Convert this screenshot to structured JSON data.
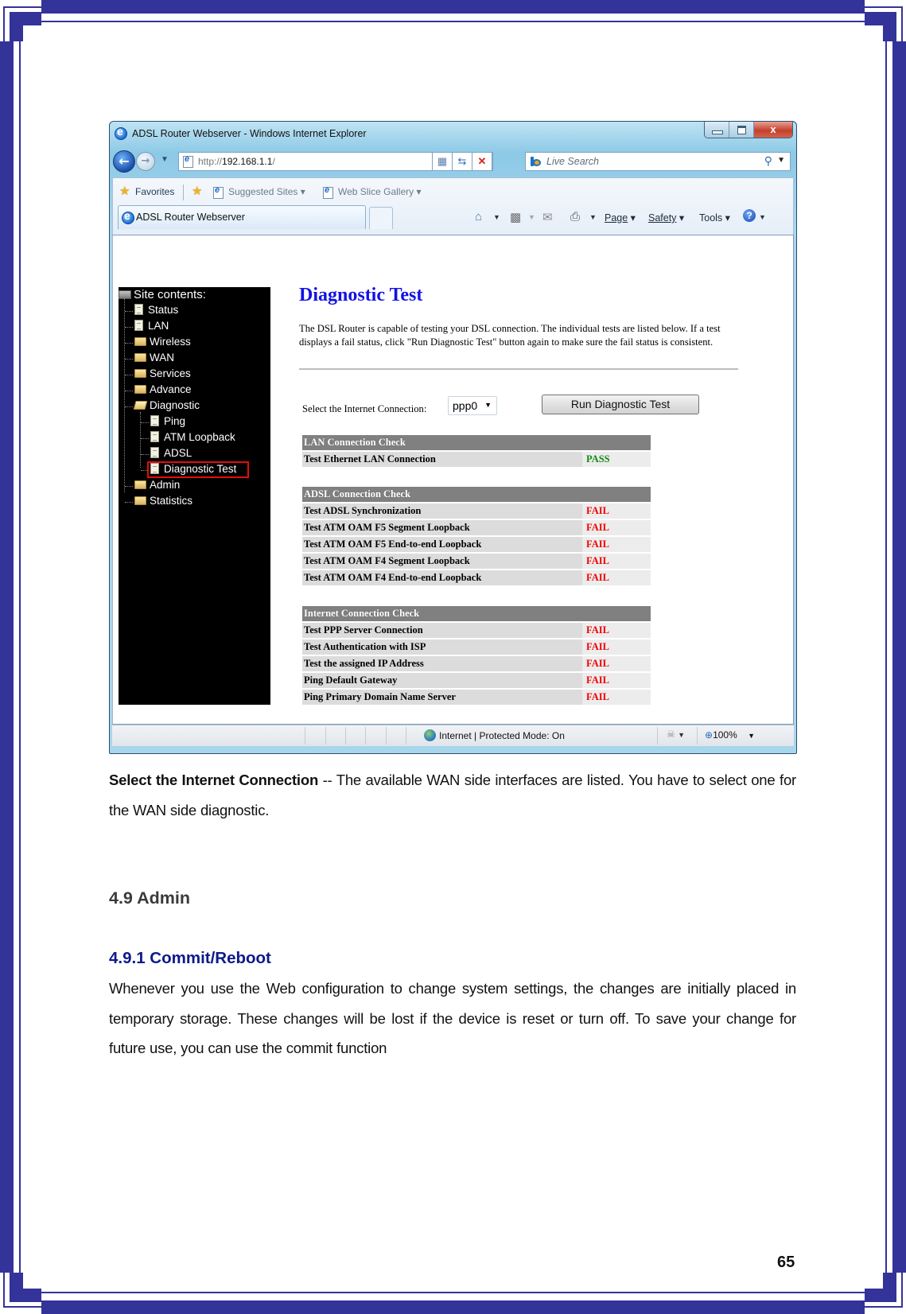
{
  "page": {
    "page_number": "65",
    "frame_color": "#33339a"
  },
  "browser": {
    "window_title": "ADSL Router Webserver - Windows Internet Explorer",
    "close_glyph": "x",
    "address_prefix": "http://",
    "address_host": "192.168.1.1",
    "address_suffix": "/",
    "search_placeholder": "Live Search",
    "favorites_label": "Favorites",
    "suggested_sites_label": "Suggested Sites",
    "web_slice_gallery_label": "Web Slice Gallery",
    "tab_title": "ADSL Router Webserver",
    "commands": {
      "page": "Page",
      "safety": "Safety",
      "tools": "Tools"
    },
    "status": {
      "zone": "Internet | Protected Mode: On",
      "zoom": "100%"
    }
  },
  "sidebar": {
    "root_label": "Site contents:",
    "items": [
      {
        "label": "Status",
        "type": "doc",
        "level": 1
      },
      {
        "label": "LAN",
        "type": "doc",
        "level": 1
      },
      {
        "label": "Wireless",
        "type": "folder",
        "level": 1
      },
      {
        "label": "WAN",
        "type": "folder",
        "level": 1
      },
      {
        "label": "Services",
        "type": "folder",
        "level": 1
      },
      {
        "label": "Advance",
        "type": "folder",
        "level": 1
      },
      {
        "label": "Diagnostic",
        "type": "folder-open",
        "level": 1
      },
      {
        "label": "Ping",
        "type": "doc",
        "level": 2
      },
      {
        "label": "ATM Loopback",
        "type": "doc",
        "level": 2
      },
      {
        "label": "ADSL",
        "type": "doc",
        "level": 2
      },
      {
        "label": "Diagnostic Test",
        "type": "doc",
        "level": 2,
        "selected": true
      },
      {
        "label": "Admin",
        "type": "folder",
        "level": 1
      },
      {
        "label": "Statistics",
        "type": "folder",
        "level": 1
      }
    ]
  },
  "main": {
    "title": "Diagnostic Test",
    "intro": "The DSL Router is capable of testing your DSL connection. The individual tests are listed below. If a test displays a fail status, click \"Run Diagnostic Test\" button again to make sure the fail status is consistent.",
    "connection_label": "Select the Internet Connection:",
    "connection_value": "ppp0",
    "run_button": "Run Diagnostic Test",
    "sections": [
      {
        "header": "LAN Connection Check",
        "rows": [
          {
            "test": "Test Ethernet LAN Connection",
            "result": "PASS"
          }
        ]
      },
      {
        "header": "ADSL Connection Check",
        "rows": [
          {
            "test": "Test ADSL Synchronization",
            "result": "FAIL"
          },
          {
            "test": "Test ATM OAM F5 Segment Loopback",
            "result": "FAIL"
          },
          {
            "test": "Test ATM OAM F5 End-to-end Loopback",
            "result": "FAIL"
          },
          {
            "test": "Test ATM OAM F4 Segment Loopback",
            "result": "FAIL"
          },
          {
            "test": "Test ATM OAM F4 End-to-end Loopback",
            "result": "FAIL"
          }
        ]
      },
      {
        "header": "Internet Connection Check",
        "rows": [
          {
            "test": "Test PPP Server Connection",
            "result": "FAIL"
          },
          {
            "test": "Test Authentication with ISP",
            "result": "FAIL"
          },
          {
            "test": "Test the assigned IP Address",
            "result": "FAIL"
          },
          {
            "test": "Ping Default Gateway",
            "result": "FAIL"
          },
          {
            "test": "Ping Primary Domain Name Server",
            "result": "FAIL"
          }
        ]
      }
    ]
  },
  "document": {
    "caption_bold": "Select the Internet Connection",
    "caption_rest": " -- The available WAN side interfaces are listed. You have to select one for the WAN side diagnostic.",
    "section_heading": "4.9 Admin",
    "subsection_heading": "4.9.1 Commit/Reboot",
    "body": "Whenever you use the Web configuration to change system settings, the changes are initially placed in temporary storage. These changes will be lost if the device is reset or turn off. To save your change for future use, you can use the commit function"
  }
}
